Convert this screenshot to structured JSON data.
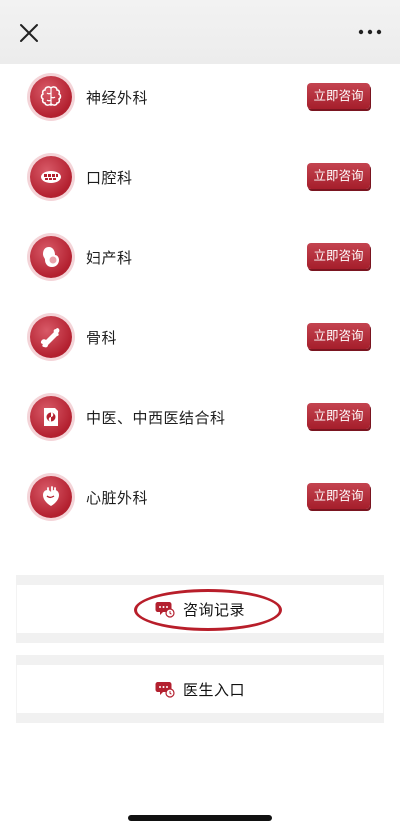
{
  "topbar": {
    "close_icon": "close-icon",
    "more_icon": "more-icon"
  },
  "departments": [
    {
      "name": "神经外科",
      "icon": "brain-icon",
      "button": "立即咨询"
    },
    {
      "name": "口腔科",
      "icon": "teeth-icon",
      "button": "立即咨询"
    },
    {
      "name": "妇产科",
      "icon": "pregnancy-icon",
      "button": "立即咨询"
    },
    {
      "name": "骨科",
      "icon": "bone-icon",
      "button": "立即咨询"
    },
    {
      "name": "中医、中西医结合科",
      "icon": "chinese-medicine-icon",
      "button": "立即咨询"
    },
    {
      "name": "心脏外科",
      "icon": "heart-icon",
      "button": "立即咨询"
    }
  ],
  "actions": {
    "consult_records": {
      "label": "咨询记录",
      "icon": "chat-clock-icon",
      "highlighted": true
    },
    "doctor_entry": {
      "label": "医生入口",
      "icon": "chat-clock-icon"
    }
  },
  "colors": {
    "accent": "#b3202f",
    "highlight": "#b81e2a"
  }
}
